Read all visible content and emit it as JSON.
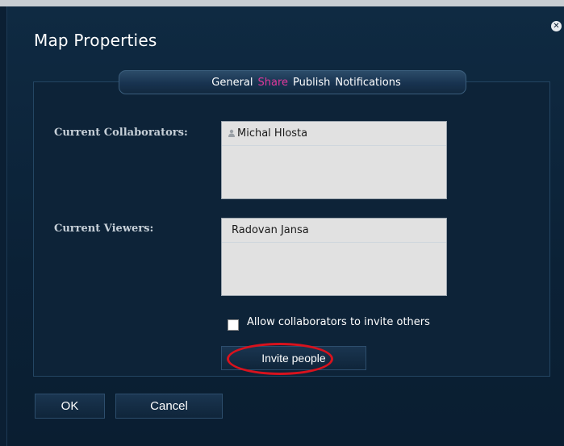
{
  "dialog": {
    "title": "Map Properties",
    "close_glyph": "✕"
  },
  "tabs": [
    {
      "label": "General",
      "active": false
    },
    {
      "label": "Share",
      "active": true
    },
    {
      "label": "Publish",
      "active": false
    },
    {
      "label": "Notifications",
      "active": false
    }
  ],
  "share": {
    "collaborators_label": "Current Collaborators:",
    "collaborators": [
      "Michal Hlosta"
    ],
    "viewers_label": "Current Viewers:",
    "viewers": [
      "Radovan Jansa"
    ],
    "allow_invite_label": "Allow collaborators to invite others",
    "allow_invite_checked": false,
    "invite_button_label": "Invite people"
  },
  "footer": {
    "ok_label": "OK",
    "cancel_label": "Cancel"
  },
  "colors": {
    "active_tab": "#e0389a",
    "annotation": "#d8121d"
  },
  "icons": {
    "collaborator": "person-icon",
    "close": "close-icon"
  }
}
